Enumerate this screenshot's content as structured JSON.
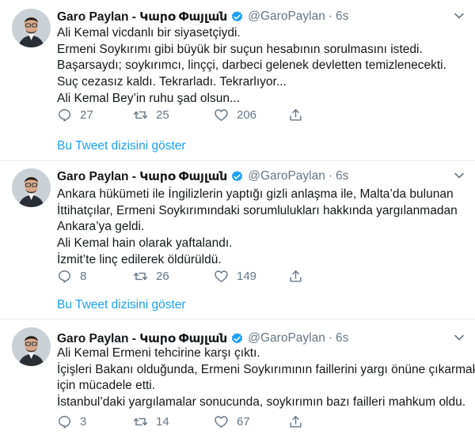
{
  "colors": {
    "accent": "#1da1f2",
    "muted": "#657786",
    "text": "#14171a",
    "divider": "#e6ecf0"
  },
  "tweets": [
    {
      "author_name": "Garo Paylan - Կարօ Փայլան",
      "handle": "@GaroPaylan",
      "separator": "·",
      "time": "6s",
      "lines": [
        "Ali Kemal vicdanlı bir siyasetçiydi.",
        "Ermeni Soykırımı gibi büyük bir suçun hesabının sorulmasını istedi.",
        "Başarsaydı; soykırımcı, linççi, darbeci gelenek devletten temizlenecekti.",
        "Suç cezasız kaldı. Tekrarladı. Tekrarlıyor...",
        "Ali Kemal Bey’in ruhu şad olsun..."
      ],
      "replies": "27",
      "retweets": "25",
      "likes": "206",
      "thread_link": "Bu Tweet dizisini göster"
    },
    {
      "author_name": "Garo Paylan - Կարօ Փայլան",
      "handle": "@GaroPaylan",
      "separator": "·",
      "time": "6s",
      "lines": [
        "Ankara hükümeti ile İngilizlerin yaptığı gizli anlaşma ile, Malta’da bulunan",
        "İttihatçılar, Ermeni Soykırımındaki sorumlulukları hakkında yargılanmadan",
        "Ankara’ya geldi.",
        "Ali Kemal hain olarak yaftalandı.",
        "İzmit’te linç edilerek öldürüldü."
      ],
      "replies": "8",
      "retweets": "26",
      "likes": "149",
      "thread_link": "Bu Tweet dizisini göster"
    },
    {
      "author_name": "Garo Paylan - Կարօ Փայլան",
      "handle": "@GaroPaylan",
      "separator": "·",
      "time": "6s",
      "lines": [
        "Ali Kemal Ermeni tehcirine karşı çıktı.",
        "İçişleri Bakanı olduğunda, Ermeni Soykırımının faillerini yargı önüne çıkarmak",
        "için mücadele etti.",
        "İstanbul’daki yargılamalar sonucunda, soykırımın bazı failleri mahkum oldu."
      ],
      "replies": "3",
      "retweets": "14",
      "likes": "67"
    }
  ]
}
